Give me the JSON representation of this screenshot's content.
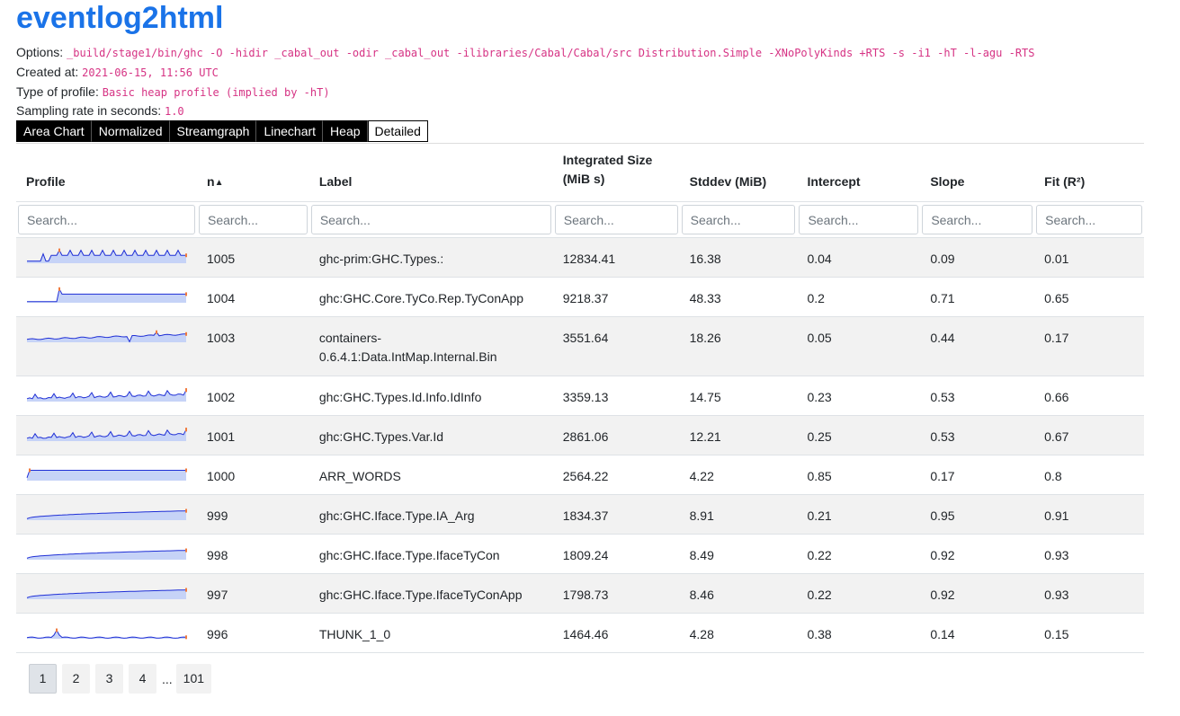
{
  "app": {
    "title": "eventlog2html"
  },
  "meta": [
    {
      "label": "Options:",
      "value": "_build/stage1/bin/ghc -O -hidir _cabal_out -odir _cabal_out -ilibraries/Cabal/Cabal/src Distribution.Simple -XNoPolyKinds +RTS -s -i1 -hT -l-agu -RTS"
    },
    {
      "label": "Created at:",
      "value": "2021-06-15, 11:56 UTC"
    },
    {
      "label": "Type of profile:",
      "value": "Basic heap profile (implied by -hT)"
    },
    {
      "label": "Sampling rate in seconds:",
      "value": "1.0"
    }
  ],
  "tabs": [
    {
      "label": "Area Chart",
      "active": false
    },
    {
      "label": "Normalized",
      "active": false
    },
    {
      "label": "Streamgraph",
      "active": false
    },
    {
      "label": "Linechart",
      "active": false
    },
    {
      "label": "Heap",
      "active": false
    },
    {
      "label": "Detailed",
      "active": true
    }
  ],
  "table": {
    "headers": {
      "profile": "Profile",
      "n": "n",
      "n_sort": "▲",
      "label": "Label",
      "integrated": "Integrated Size (MiB s)",
      "stddev": "Stddev (MiB)",
      "intercept": "Intercept",
      "slope": "Slope",
      "fit": "Fit (R²)"
    },
    "search_placeholder": "Search...",
    "rows": [
      {
        "n": "1005",
        "label": "ghc-prim:GHC.Types.:",
        "integrated": "12834.41",
        "stddev": "16.38",
        "intercept": "0.04",
        "slope": "0.09",
        "fit": "0.01",
        "spark": "spiky"
      },
      {
        "n": "1004",
        "label": "ghc:GHC.Core.TyCo.Rep.TyConApp",
        "integrated": "9218.37",
        "stddev": "48.33",
        "intercept": "0.2",
        "slope": "0.71",
        "fit": "0.65",
        "spark": "jump"
      },
      {
        "n": "1003",
        "label": "containers-0.6.4.1:Data.IntMap.Internal.Bin",
        "integrated": "3551.64",
        "stddev": "18.26",
        "intercept": "0.05",
        "slope": "0.44",
        "fit": "0.17",
        "spark": "wavy"
      },
      {
        "n": "1002",
        "label": "ghc:GHC.Types.Id.Info.IdInfo",
        "integrated": "3359.13",
        "stddev": "14.75",
        "intercept": "0.23",
        "slope": "0.53",
        "fit": "0.66",
        "spark": "noisy"
      },
      {
        "n": "1001",
        "label": "ghc:GHC.Types.Var.Id",
        "integrated": "2861.06",
        "stddev": "12.21",
        "intercept": "0.25",
        "slope": "0.53",
        "fit": "0.67",
        "spark": "noisy"
      },
      {
        "n": "1000",
        "label": "ARR_WORDS",
        "integrated": "2564.22",
        "stddev": "4.22",
        "intercept": "0.85",
        "slope": "0.17",
        "fit": "0.8",
        "spark": "flat"
      },
      {
        "n": "999",
        "label": "ghc:GHC.Iface.Type.IA_Arg",
        "integrated": "1834.37",
        "stddev": "8.91",
        "intercept": "0.21",
        "slope": "0.95",
        "fit": "0.91",
        "spark": "rising"
      },
      {
        "n": "998",
        "label": "ghc:GHC.Iface.Type.IfaceTyCon",
        "integrated": "1809.24",
        "stddev": "8.49",
        "intercept": "0.22",
        "slope": "0.92",
        "fit": "0.93",
        "spark": "rising"
      },
      {
        "n": "997",
        "label": "ghc:GHC.Iface.Type.IfaceTyConApp",
        "integrated": "1798.73",
        "stddev": "8.46",
        "intercept": "0.22",
        "slope": "0.92",
        "fit": "0.93",
        "spark": "rising"
      },
      {
        "n": "996",
        "label": "THUNK_1_0",
        "integrated": "1464.46",
        "stddev": "4.28",
        "intercept": "0.38",
        "slope": "0.14",
        "fit": "0.15",
        "spark": "lowspike"
      }
    ]
  },
  "pagination": {
    "pages": [
      "1",
      "2",
      "3",
      "4"
    ],
    "ellipsis": "...",
    "last": "101",
    "active": "1"
  },
  "colors": {
    "title": "#1a73e8",
    "spark_line": "#1f2fd6",
    "spark_fill": "#c6d3f7",
    "spark_marker": "#f07b3f"
  }
}
